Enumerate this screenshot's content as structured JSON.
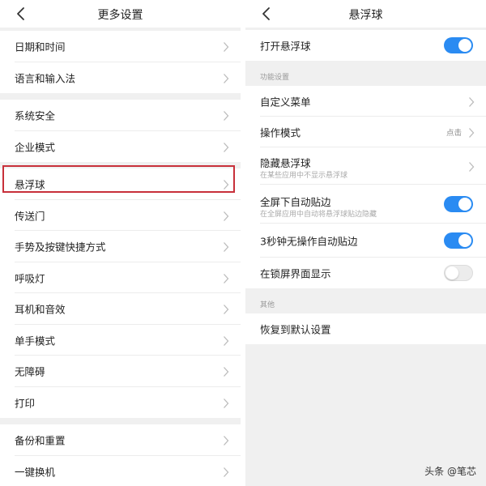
{
  "left": {
    "title": "更多设置",
    "groups": [
      [
        "日期和时间",
        "语言和输入法"
      ],
      [
        "系统安全",
        "企业模式"
      ],
      [
        "悬浮球",
        "传送门",
        "手势及按键快捷方式",
        "呼吸灯",
        "耳机和音效",
        "单手模式",
        "无障碍",
        "打印"
      ],
      [
        "备份和重置",
        "一键换机"
      ]
    ]
  },
  "right": {
    "title": "悬浮球",
    "main_toggle": {
      "label": "打开悬浮球",
      "on": true
    },
    "section1_label": "功能设置",
    "custom_menu": "自定义菜单",
    "operation_mode": {
      "label": "操作模式",
      "value": "点击"
    },
    "hide_ball": {
      "label": "隐藏悬浮球",
      "sub": "在某些应用中不显示悬浮球"
    },
    "fullscreen_snap": {
      "label": "全屏下自动贴边",
      "sub": "在全屏应用中自动将悬浮球贴边隐藏",
      "on": true
    },
    "idle_snap": {
      "label": "3秒钟无操作自动贴边",
      "on": true
    },
    "lockscreen_show": {
      "label": "在锁屏界面显示",
      "on": false
    },
    "section2_label": "其他",
    "reset": "恢复到默认设置"
  },
  "watermark": "头条 @笔芯",
  "colors": {
    "accent": "#2a8bf2",
    "highlight": "#c8303a"
  }
}
